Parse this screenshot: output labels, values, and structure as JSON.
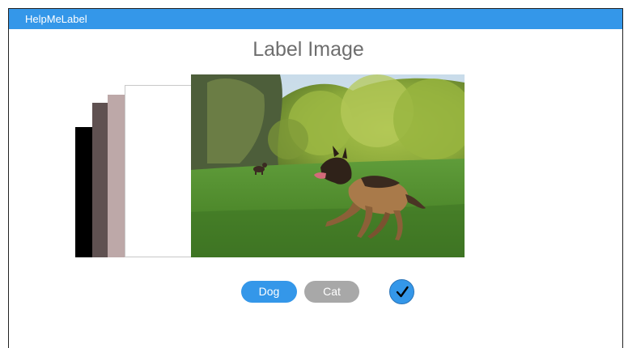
{
  "app": {
    "title": "HelpMeLabel"
  },
  "main": {
    "heading": "Label Image"
  },
  "labels": {
    "dog": "Dog",
    "cat": "Cat"
  },
  "icons": {
    "confirm": "checkmark-icon"
  },
  "colors": {
    "accent": "#3497e9",
    "inactive": "#a8a8a8"
  }
}
